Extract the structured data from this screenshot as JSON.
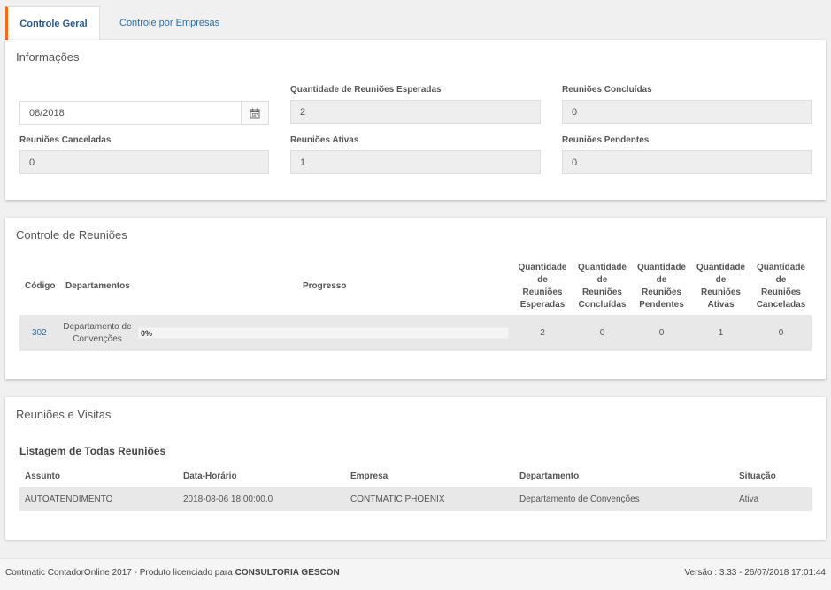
{
  "tabs": [
    {
      "label": "Controle Geral",
      "active": true
    },
    {
      "label": "Controle por Empresas",
      "active": false
    }
  ],
  "info": {
    "title": "Informações",
    "date_value": "08/2018",
    "fields": {
      "esperadas": {
        "label": "Quantidade de Reuniões Esperadas",
        "value": "2"
      },
      "concluidas": {
        "label": "Reuniões Concluídas",
        "value": "0"
      },
      "canceladas": {
        "label": "Reuniões Canceladas",
        "value": "0"
      },
      "ativas": {
        "label": "Reuniões Ativas",
        "value": "1"
      },
      "pendentes": {
        "label": "Reuniões Pendentes",
        "value": "0"
      }
    }
  },
  "controle": {
    "title": "Controle de Reuniões",
    "headers": {
      "codigo": "Código",
      "departamentos": "Departamentos",
      "progresso": "Progresso",
      "esperadas": [
        "Quantidade",
        "de",
        "Reuniões",
        "Esperadas"
      ],
      "concluidas": [
        "Quantidade",
        "de",
        "Reuniões",
        "Concluídas"
      ],
      "pendentes": [
        "Quantidade",
        "de",
        "Reuniões",
        "Pendentes"
      ],
      "ativas": [
        "Quantidade",
        "de",
        "Reuniões",
        "Ativas"
      ],
      "canceladas": [
        "Quantidade",
        "de",
        "Reuniões",
        "Canceladas"
      ]
    },
    "rows": [
      {
        "codigo": "302",
        "departamento": "Departamento de Convenções",
        "progresso_text": "0%",
        "progresso": 0,
        "esperadas": "2",
        "concluidas": "0",
        "pendentes": "0",
        "ativas": "1",
        "canceladas": "0"
      }
    ]
  },
  "visitas": {
    "title": "Reuniões e Visitas",
    "list_title": "Listagem de Todas Reuniões",
    "headers": {
      "assunto": "Assunto",
      "data": "Data-Horário",
      "empresa": "Empresa",
      "departamento": "Departamento",
      "situacao": "Situação"
    },
    "rows": [
      {
        "assunto": "AUTOATENDIMENTO",
        "data": "2018-08-06 18:00:00.0",
        "empresa": "CONTMATIC PHOENIX",
        "departamento": "Departamento de Convenções",
        "situacao": "Ativa"
      }
    ]
  },
  "footer": {
    "left_text": "Contmatic ContadorOnline 2017 - Produto licenciado para",
    "licensee": "CONSULTORIA GESCON",
    "version": "Versão : 3.33 - 26/07/2018 17:01:44"
  },
  "colors": {
    "accent_tab": "#ef6c1a",
    "link": "#2e6da4",
    "progress": "#5cb85c"
  },
  "icons": {
    "date_picker": "calendar-icon"
  }
}
